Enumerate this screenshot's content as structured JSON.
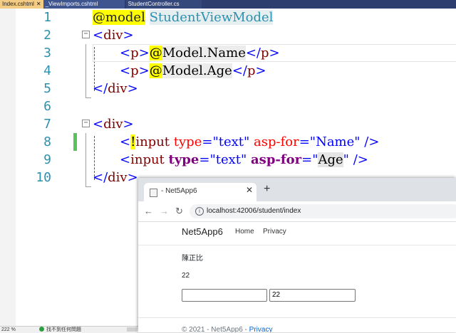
{
  "vs": {
    "tabs": [
      {
        "label": "Index.cshtml",
        "close": "✕"
      },
      {
        "label": "_ViewImports.cshtml"
      },
      {
        "label": "StudentController.cs"
      }
    ],
    "status": {
      "zoom": "222 %",
      "issues": "找不到任何問題"
    }
  },
  "code": {
    "line_numbers": [
      "1",
      "2",
      "3",
      "4",
      "5",
      "6",
      "7",
      "8",
      "9",
      "10"
    ],
    "l1": {
      "directive": "@model",
      "type": "StudentViewModel"
    },
    "div_tag": "div",
    "p_tag": "p",
    "at": "@",
    "l3_expr": "Model.Name",
    "l4_expr": "Model.Age",
    "l8": {
      "bang": "!",
      "tag": "input",
      "attr1": "type",
      "val1": "\"text\"",
      "attr2": "asp-for",
      "val2": "\"Name\"",
      "close": "/>"
    },
    "l9": {
      "tag": "input",
      "attr1": "type",
      "val1": "\"text\"",
      "attr2": "asp-for",
      "val2_open": "\"",
      "val2_word": "Age",
      "val2_close": "\"",
      "close": "/>"
    }
  },
  "browser": {
    "tab_title": "- Net5App6",
    "tab_close": "✕",
    "new_tab": "+",
    "back": "←",
    "forward": "→",
    "reload": "↻",
    "info": "i",
    "url": "localhost:42006/student/index",
    "page": {
      "brand": "Net5App6",
      "nav": [
        "Home",
        "Privacy"
      ],
      "name_text": "陳正比",
      "age_text": "22",
      "input_name_value": "",
      "input_age_value": "22",
      "footer_prefix": "© 2021 - Net5App6 - ",
      "footer_link": "Privacy"
    }
  }
}
